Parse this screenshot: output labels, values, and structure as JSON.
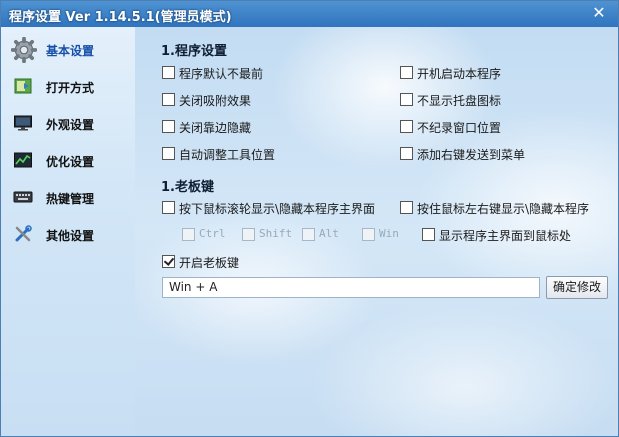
{
  "window": {
    "title": "程序设置  Ver 1.14.5.1(管理员模式)",
    "close_glyph": "✕"
  },
  "sidebar": {
    "items": [
      {
        "label": "基本设置",
        "icon": "gear-icon",
        "active": true
      },
      {
        "label": "打开方式",
        "icon": "folder-icon"
      },
      {
        "label": "外观设置",
        "icon": "monitor-icon"
      },
      {
        "label": "优化设置",
        "icon": "optimize-icon"
      },
      {
        "label": "热键管理",
        "icon": "keyboard-icon"
      },
      {
        "label": "其他设置",
        "icon": "tools-icon"
      }
    ]
  },
  "section1": {
    "title": "1.程序设置",
    "options": [
      {
        "label": "程序默认不最前",
        "checked": false
      },
      {
        "label": "开机启动本程序",
        "checked": false
      },
      {
        "label": "关闭吸附效果",
        "checked": false
      },
      {
        "label": "不显示托盘图标",
        "checked": false
      },
      {
        "label": "关闭靠边隐藏",
        "checked": false
      },
      {
        "label": "不纪录窗口位置",
        "checked": false
      },
      {
        "label": "自动调整工具位置",
        "checked": false
      },
      {
        "label": "添加右键发送到菜单",
        "checked": false
      }
    ]
  },
  "section2": {
    "title": "1.老板键",
    "wheel_toggle": {
      "label": "按下鼠标滚轮显示\\隐藏本程序主界面",
      "checked": false
    },
    "lr_toggle": {
      "label": "按住鼠标左右键显示\\隐藏本程序",
      "checked": false
    },
    "modifiers": [
      {
        "label": "Ctrl",
        "checked": false,
        "disabled": true
      },
      {
        "label": "Shift",
        "checked": false,
        "disabled": true
      },
      {
        "label": "Alt",
        "checked": false,
        "disabled": true
      },
      {
        "label": "Win",
        "checked": false,
        "disabled": true
      }
    ],
    "show_at_mouse": {
      "label": "显示程序主界面到鼠标处",
      "checked": false
    },
    "enable_boss_key": {
      "label": "开启老板键",
      "checked": true
    },
    "hotkey_value": "Win +  A",
    "confirm_label": "确定修改"
  }
}
